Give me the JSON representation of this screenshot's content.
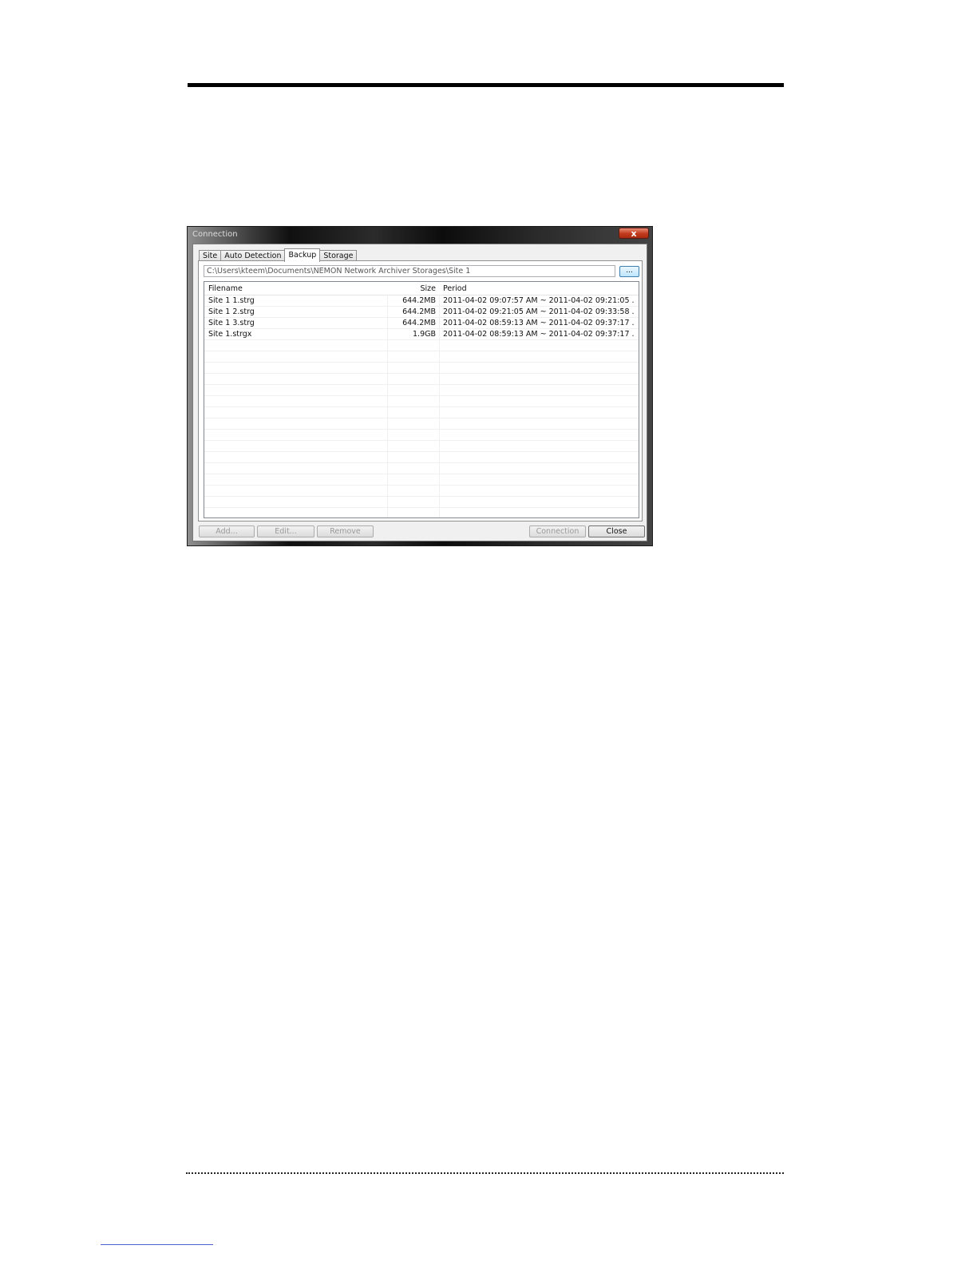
{
  "window": {
    "title": "Connection",
    "close_glyph": "x"
  },
  "tabs": [
    {
      "label": "Site",
      "active": false
    },
    {
      "label": "Auto Detection",
      "active": false
    },
    {
      "label": "Backup",
      "active": true
    },
    {
      "label": "Storage",
      "active": false
    }
  ],
  "backup": {
    "path_value": "C:\\Users\\kteem\\Documents\\NEMON Network Archiver Storages\\Site 1",
    "browse_label": "...",
    "columns": {
      "filename": "Filename",
      "size": "Size",
      "period": "Period"
    },
    "rows": [
      {
        "filename": "Site 1 1.strg",
        "size": "644.2MB",
        "period": "2011-04-02 09:07:57 AM ~ 2011-04-02 09:21:05 ..."
      },
      {
        "filename": "Site 1 2.strg",
        "size": "644.2MB",
        "period": "2011-04-02 09:21:05 AM ~ 2011-04-02 09:33:58 ..."
      },
      {
        "filename": "Site 1 3.strg",
        "size": "644.2MB",
        "period": "2011-04-02 08:59:13 AM ~ 2011-04-02 09:37:17 ..."
      },
      {
        "filename": "Site 1.strgx",
        "size": "1.9GB",
        "period": "2011-04-02 08:59:13 AM ~ 2011-04-02 09:37:17 ..."
      }
    ]
  },
  "buttons": {
    "add": "Add...",
    "edit": "Edit...",
    "remove": "Remove",
    "connection": "Connection",
    "close": "Close"
  }
}
